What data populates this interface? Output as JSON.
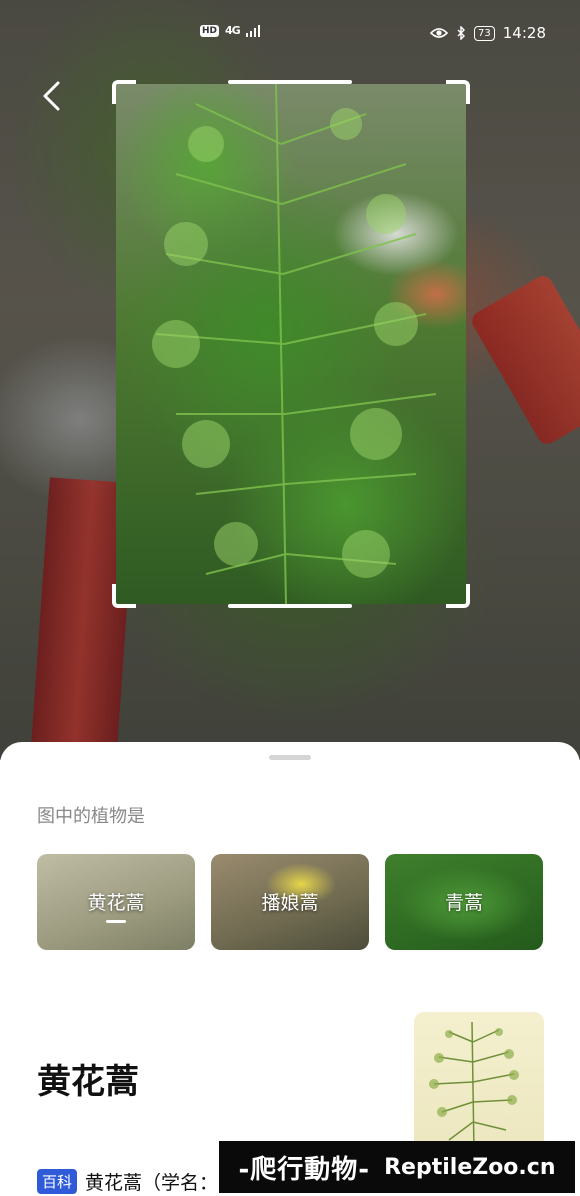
{
  "status_bar": {
    "hd_badge": "HD",
    "network": "4G",
    "battery": "73",
    "time": "14:28"
  },
  "camera": {
    "back_icon": "chevron-left-icon"
  },
  "result_sheet": {
    "question": "图中的植物是",
    "candidates": [
      {
        "label": "黄花蒿",
        "selected": true
      },
      {
        "label": "播娘蒿",
        "selected": false
      },
      {
        "label": "青蒿",
        "selected": false
      }
    ],
    "species_name": "黄花蒿",
    "encyclopedia": {
      "badge": "百科",
      "text": "黄花蒿（学名："
    }
  },
  "watermark": {
    "chinese": "-爬行動物-",
    "english": "ReptileZoo.cn"
  }
}
